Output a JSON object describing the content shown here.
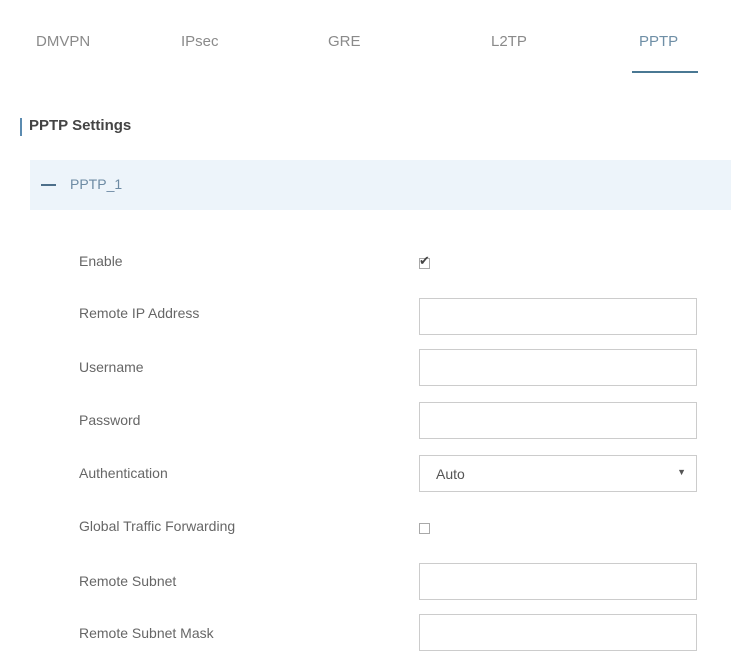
{
  "tabs": [
    {
      "label": "DMVPN"
    },
    {
      "label": "IPsec"
    },
    {
      "label": "GRE"
    },
    {
      "label": "L2TP"
    },
    {
      "label": "PPTP"
    }
  ],
  "active_tab": "PPTP",
  "section": {
    "title": "PPTP Settings"
  },
  "group": {
    "label": "PPTP_1"
  },
  "fields": {
    "enable": {
      "label": "Enable",
      "checked": true
    },
    "remote_ip": {
      "label": "Remote IP Address",
      "value": ""
    },
    "username": {
      "label": "Username",
      "value": ""
    },
    "password": {
      "label": "Password",
      "value": ""
    },
    "authentication": {
      "label": "Authentication",
      "selected": "Auto"
    },
    "global_traffic_forwarding": {
      "label": "Global Traffic Forwarding",
      "checked": false
    },
    "remote_subnet": {
      "label": "Remote Subnet",
      "value": ""
    },
    "remote_subnet_mask": {
      "label": "Remote Subnet Mask",
      "value": ""
    }
  },
  "colors": {
    "accent": "#4a7893",
    "group_header_bg": "#edf4fa"
  },
  "icons": {
    "collapse": "minus-icon",
    "check": "check-icon",
    "dropdown": "caret-down-icon"
  }
}
